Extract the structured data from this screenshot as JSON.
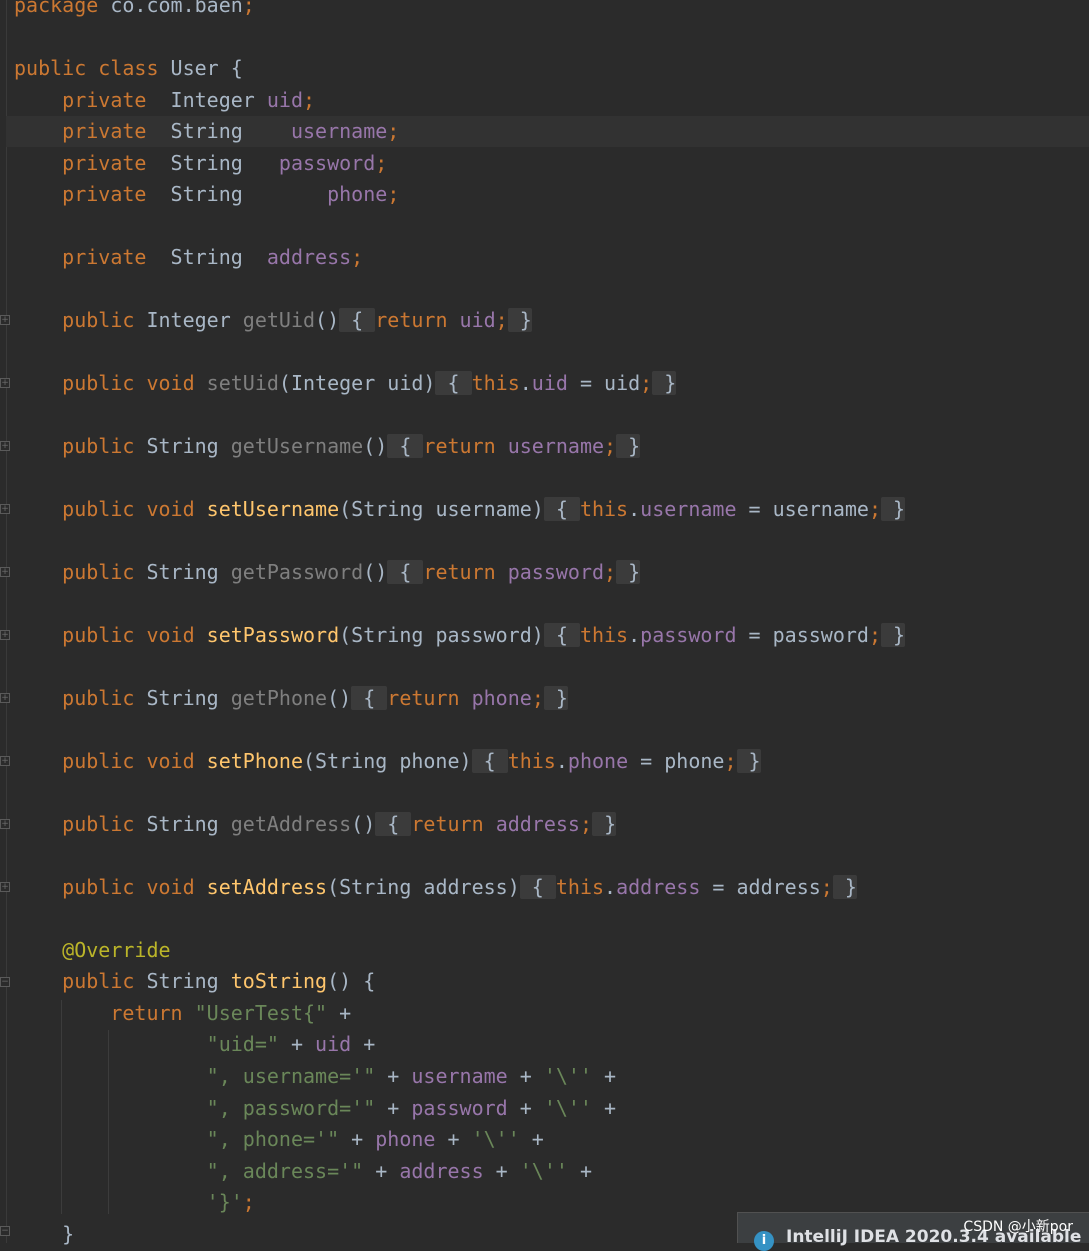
{
  "editor": {
    "lines": [
      {
        "id": "package-line",
        "tokens": [
          [
            "kw",
            "package"
          ],
          [
            "plain",
            " co.com.baen"
          ],
          [
            "kw",
            ";"
          ]
        ]
      },
      {
        "id": "class-declaration",
        "tokens": [
          [
            "kw",
            "public class "
          ],
          [
            "plain",
            "User {"
          ]
        ]
      },
      {
        "id": "field-uid",
        "tokens": [
          [
            "kw",
            "    private  "
          ],
          [
            "plain",
            "Integer "
          ],
          [
            "fld",
            "uid"
          ],
          [
            "kw",
            ";"
          ]
        ]
      },
      {
        "id": "field-username",
        "tokens": [
          [
            "kw",
            "    private  "
          ],
          [
            "plain",
            "String    "
          ],
          [
            "fld",
            "username"
          ],
          [
            "kw",
            ";"
          ]
        ]
      },
      {
        "id": "field-password",
        "tokens": [
          [
            "kw",
            "    private  "
          ],
          [
            "plain",
            "String   "
          ],
          [
            "fld",
            "password"
          ],
          [
            "kw",
            ";"
          ]
        ]
      },
      {
        "id": "field-phone",
        "tokens": [
          [
            "kw",
            "    private  "
          ],
          [
            "plain",
            "String       "
          ],
          [
            "fld",
            "phone"
          ],
          [
            "kw",
            ";"
          ]
        ]
      },
      {
        "id": "field-address",
        "tokens": [
          [
            "kw",
            "    private  "
          ],
          [
            "plain",
            "String  "
          ],
          [
            "fld",
            "address"
          ],
          [
            "kw",
            ";"
          ]
        ]
      },
      {
        "id": "method-getuid",
        "tokens": [
          [
            "kw",
            "    public "
          ],
          [
            "plain",
            "Integer "
          ],
          [
            "mute",
            "getUid"
          ],
          [
            "plain",
            "()"
          ],
          [
            "fold",
            " { "
          ],
          [
            "kw",
            "return "
          ],
          [
            "fld",
            "uid"
          ],
          [
            "kw",
            ";"
          ],
          [
            "fold",
            " }"
          ]
        ]
      },
      {
        "id": "method-setuid",
        "tokens": [
          [
            "kw",
            "    public void "
          ],
          [
            "mute",
            "setUid"
          ],
          [
            "plain",
            "(Integer uid)"
          ],
          [
            "fold",
            " { "
          ],
          [
            "kw",
            "this"
          ],
          [
            "plain",
            "."
          ],
          [
            "fld",
            "uid"
          ],
          [
            "plain",
            " = uid"
          ],
          [
            "kw",
            ";"
          ],
          [
            "fold",
            " }"
          ]
        ]
      },
      {
        "id": "method-getusername",
        "tokens": [
          [
            "kw",
            "    public "
          ],
          [
            "plain",
            "String "
          ],
          [
            "mute",
            "getUsername"
          ],
          [
            "plain",
            "()"
          ],
          [
            "fold",
            " { "
          ],
          [
            "kw",
            "return "
          ],
          [
            "fld",
            "username"
          ],
          [
            "kw",
            ";"
          ],
          [
            "fold",
            " }"
          ]
        ]
      },
      {
        "id": "method-setusername",
        "tokens": [
          [
            "kw",
            "    public void "
          ],
          [
            "fn",
            "setUsername"
          ],
          [
            "plain",
            "(String username)"
          ],
          [
            "fold",
            " { "
          ],
          [
            "kw",
            "this"
          ],
          [
            "plain",
            "."
          ],
          [
            "fld",
            "username"
          ],
          [
            "plain",
            " = username"
          ],
          [
            "kw",
            ";"
          ],
          [
            "fold",
            " }"
          ]
        ]
      },
      {
        "id": "method-getpassword",
        "tokens": [
          [
            "kw",
            "    public "
          ],
          [
            "plain",
            "String "
          ],
          [
            "mute",
            "getPassword"
          ],
          [
            "plain",
            "()"
          ],
          [
            "fold",
            " { "
          ],
          [
            "kw",
            "return "
          ],
          [
            "fld",
            "password"
          ],
          [
            "kw",
            ";"
          ],
          [
            "fold",
            " }"
          ]
        ]
      },
      {
        "id": "method-setpassword",
        "tokens": [
          [
            "kw",
            "    public void "
          ],
          [
            "fn",
            "setPassword"
          ],
          [
            "plain",
            "(String password)"
          ],
          [
            "fold",
            " { "
          ],
          [
            "kw",
            "this"
          ],
          [
            "plain",
            "."
          ],
          [
            "fld",
            "password"
          ],
          [
            "plain",
            " = password"
          ],
          [
            "kw",
            ";"
          ],
          [
            "fold",
            " }"
          ]
        ]
      },
      {
        "id": "method-getphone",
        "tokens": [
          [
            "kw",
            "    public "
          ],
          [
            "plain",
            "String "
          ],
          [
            "mute",
            "getPhone"
          ],
          [
            "plain",
            "()"
          ],
          [
            "fold",
            " { "
          ],
          [
            "kw",
            "return "
          ],
          [
            "fld",
            "phone"
          ],
          [
            "kw",
            ";"
          ],
          [
            "fold",
            " }"
          ]
        ]
      },
      {
        "id": "method-setphone",
        "tokens": [
          [
            "kw",
            "    public void "
          ],
          [
            "fn",
            "setPhone"
          ],
          [
            "plain",
            "(String phone)"
          ],
          [
            "fold",
            " { "
          ],
          [
            "kw",
            "this"
          ],
          [
            "plain",
            "."
          ],
          [
            "fld",
            "phone"
          ],
          [
            "plain",
            " = phone"
          ],
          [
            "kw",
            ";"
          ],
          [
            "fold",
            " }"
          ]
        ]
      },
      {
        "id": "method-getaddress",
        "tokens": [
          [
            "kw",
            "    public "
          ],
          [
            "plain",
            "String "
          ],
          [
            "mute",
            "getAddress"
          ],
          [
            "plain",
            "()"
          ],
          [
            "fold",
            " { "
          ],
          [
            "kw",
            "return "
          ],
          [
            "fld",
            "address"
          ],
          [
            "kw",
            ";"
          ],
          [
            "fold",
            " }"
          ]
        ]
      },
      {
        "id": "method-setaddress",
        "tokens": [
          [
            "kw",
            "    public void "
          ],
          [
            "fn",
            "setAddress"
          ],
          [
            "plain",
            "(String address)"
          ],
          [
            "fold",
            " { "
          ],
          [
            "kw",
            "this"
          ],
          [
            "plain",
            "."
          ],
          [
            "fld",
            "address"
          ],
          [
            "plain",
            " = address"
          ],
          [
            "kw",
            ";"
          ],
          [
            "fold",
            " }"
          ]
        ]
      },
      {
        "id": "override-annotation",
        "tokens": [
          [
            "ann",
            "    @Override"
          ]
        ]
      },
      {
        "id": "method-tostring",
        "tokens": [
          [
            "kw",
            "    public "
          ],
          [
            "plain",
            "String "
          ],
          [
            "fn",
            "toString"
          ],
          [
            "plain",
            "() {"
          ]
        ]
      },
      {
        "id": "return-line",
        "tokens": [
          [
            "kw",
            "        return "
          ],
          [
            "str",
            "\"UserTest{\""
          ],
          [
            "plain",
            " +"
          ]
        ]
      },
      {
        "id": "concat-uid",
        "tokens": [
          [
            "str",
            "                \"uid=\""
          ],
          [
            "plain",
            " + "
          ],
          [
            "fld",
            "uid"
          ],
          [
            "plain",
            " +"
          ]
        ]
      },
      {
        "id": "concat-username",
        "tokens": [
          [
            "str",
            "                \", username='\""
          ],
          [
            "plain",
            " + "
          ],
          [
            "fld",
            "username"
          ],
          [
            "plain",
            " + "
          ],
          [
            "str",
            "'\\''"
          ],
          [
            "plain",
            " +"
          ]
        ]
      },
      {
        "id": "concat-password",
        "tokens": [
          [
            "str",
            "                \", password='\""
          ],
          [
            "plain",
            " + "
          ],
          [
            "fld",
            "password"
          ],
          [
            "plain",
            " + "
          ],
          [
            "str",
            "'\\''"
          ],
          [
            "plain",
            " +"
          ]
        ]
      },
      {
        "id": "concat-phone",
        "tokens": [
          [
            "str",
            "                \", phone='\""
          ],
          [
            "plain",
            " + "
          ],
          [
            "fld",
            "phone"
          ],
          [
            "plain",
            " + "
          ],
          [
            "str",
            "'\\''"
          ],
          [
            "plain",
            " +"
          ]
        ]
      },
      {
        "id": "concat-address",
        "tokens": [
          [
            "str",
            "                \", address='\""
          ],
          [
            "plain",
            " + "
          ],
          [
            "fld",
            "address"
          ],
          [
            "plain",
            " + "
          ],
          [
            "str",
            "'\\''"
          ],
          [
            "plain",
            " +"
          ]
        ]
      },
      {
        "id": "concat-close",
        "tokens": [
          [
            "str",
            "                '}'"
          ],
          [
            "kw",
            ";"
          ]
        ]
      },
      {
        "id": "method-close",
        "tokens": [
          [
            "plain",
            "    }"
          ]
        ]
      }
    ]
  },
  "notification": {
    "icon": "info-icon",
    "title": "IntelliJ IDEA 2020.3.4 available"
  },
  "watermark": "CSDN @小新por",
  "colors": {
    "background": "#2b2b2b",
    "keyword": "#cc7832",
    "field": "#9876aa",
    "method": "#ffc66d",
    "string": "#6a8759",
    "annotation": "#bbb529",
    "text": "#a9b7c6"
  }
}
